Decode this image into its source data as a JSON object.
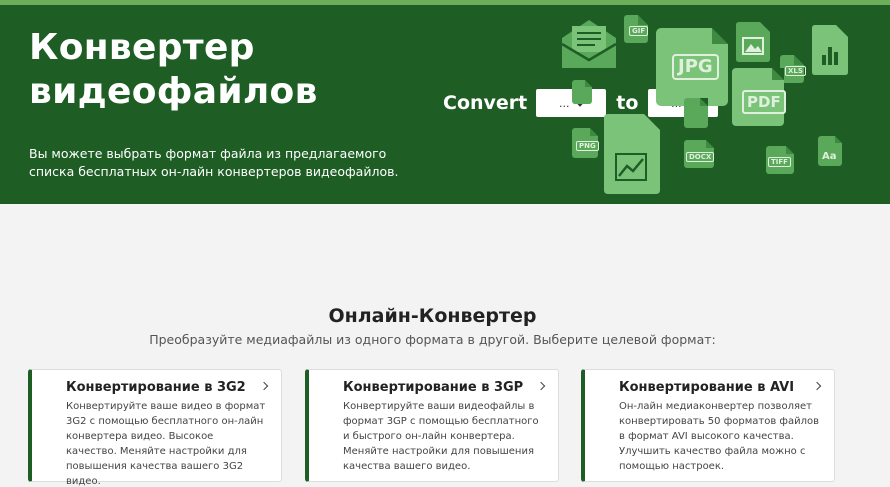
{
  "hero": {
    "title_line1": "Конвертер",
    "title_line2": "видеофайлов",
    "description": "Вы можете выбрать формат файла из предлагаемого списка бесплатных он-лайн конвертеров видеофайлов.",
    "convert_label": "Convert",
    "to_label": "to",
    "source_select_value": "...",
    "target_select_value": "...",
    "file_type_tags": [
      "GIF",
      "JPG",
      "XLS",
      "PDF",
      "PNG",
      "DOCX",
      "TIFF",
      "Aa"
    ]
  },
  "section": {
    "title": "Онлайн-Конвертер",
    "subtitle": "Преобразуйте медиафайлы из одного формата в другой. Выберите целевой формат:"
  },
  "cards": [
    {
      "title": "Конвертирование в 3G2",
      "text": "Конвертируйте ваше видео в формат 3G2 с помощью бесплатного он-лайн конвертера видео. Высокое качество. Меняйте настройки для повышения качества вашего 3G2 видео."
    },
    {
      "title": "Конвертирование в 3GP",
      "text": "Конвертируйте ваши видеофайлы в формат 3GP с помощью бесплатного и быстрого он-лайн конвертера. Меняйте настройки для повышения качества вашего видео."
    },
    {
      "title": "Конвертирование в AVI",
      "text": "Он-лайн медиаконвертер позволяет конвертировать 50 форматов файлов в формат AVI высокого качества. Улучшить качество файла можно с помощью настроек."
    }
  ],
  "colors": {
    "hero_green": "#1e5e25",
    "accent_green": "#5aa85a",
    "page_bg": "#f3f3f3"
  }
}
